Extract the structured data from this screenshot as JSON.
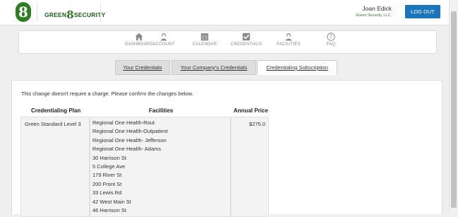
{
  "header": {
    "logo_mark": "8",
    "logo_pre": "GREEN",
    "logo_mid": "8",
    "logo_post": "SECURITY",
    "user_name": "Joan Edick",
    "user_company": "Green Security, LLC.",
    "logout_label": "LOG OUT"
  },
  "nav": {
    "items": [
      {
        "label": "DASHBOARD",
        "icon": "home-icon"
      },
      {
        "label": "ACCOUNT",
        "icon": "user-icon"
      },
      {
        "label": "CALENDAR",
        "icon": "calendar-icon"
      },
      {
        "label": "CREDENTIALS",
        "icon": "checkbox-icon"
      },
      {
        "label": "FACILITIES",
        "icon": "user-icon"
      },
      {
        "label": "FAQ",
        "icon": "question-icon"
      }
    ]
  },
  "tabs": [
    {
      "label": "Your Credentials",
      "active": false
    },
    {
      "label": "Your Company's Credentials",
      "active": false
    },
    {
      "label": "Credentialing Subscription",
      "active": true
    }
  ],
  "main": {
    "notice": "This change doesn't require a charge. Please confirm the changes below.",
    "columns": [
      "Credentialing Plan",
      "Facilities",
      "Annual Price"
    ],
    "row": {
      "plan": "Green Standard Level 3",
      "facilities": [
        "Regional One Health-Rout",
        "Regional One Health-Outpatient",
        "Regional One Health- Jefferson",
        "Regional One Health- Adams",
        "30 Harrison St",
        "5 College Ave",
        "179 River St",
        "200 Front St",
        "33 Lewis Rd",
        "42 West Main St",
        "46 Harrison St"
      ],
      "price": "$275.0"
    }
  },
  "colors": {
    "brand_green": "#2e7d22",
    "button_blue": "#1b75bb",
    "nav_icon_gray": "#8a8a8a"
  }
}
